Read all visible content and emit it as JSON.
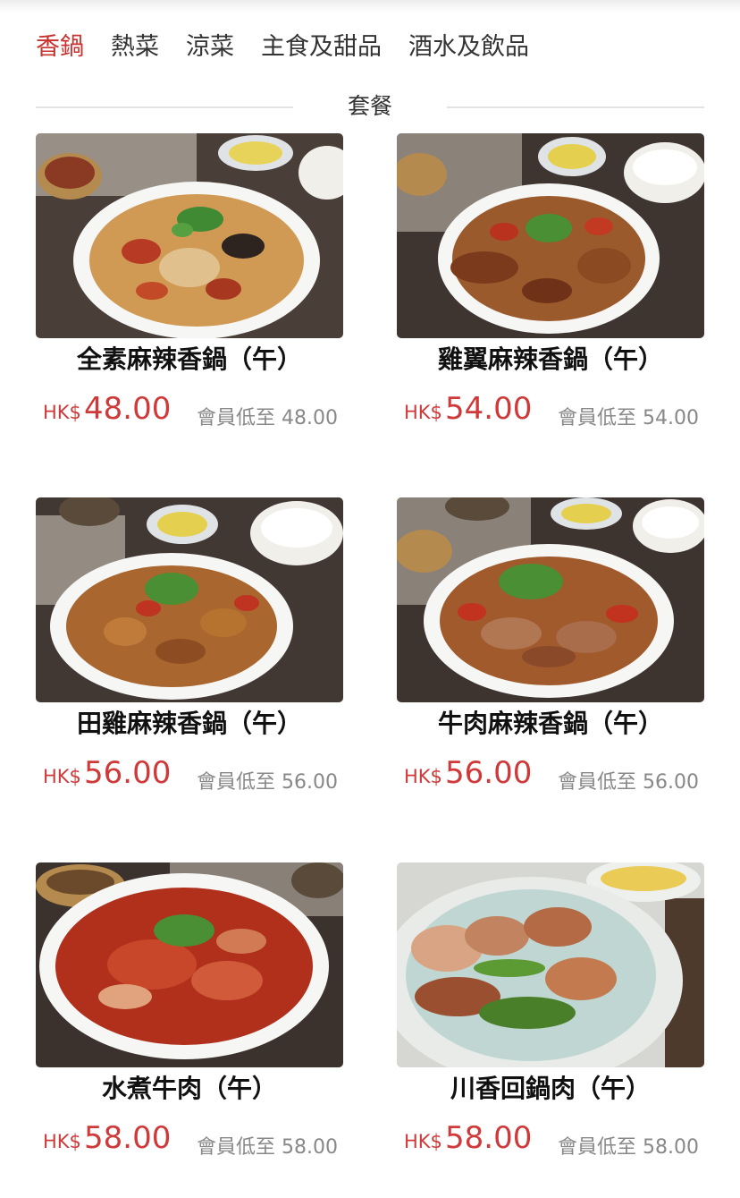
{
  "tabs": [
    {
      "label": "香鍋",
      "active": true
    },
    {
      "label": "熱菜",
      "active": false
    },
    {
      "label": "涼菜",
      "active": false
    },
    {
      "label": "主食及甜品",
      "active": false
    },
    {
      "label": "酒水及飲品",
      "active": false
    }
  ],
  "section": {
    "title": "套餐"
  },
  "dishes": [
    {
      "name": "全素麻辣香鍋（午）",
      "currency": "HK$",
      "price": "48.00",
      "member_label": "會員低至",
      "member_price": "48.00",
      "photo": "dish-photo"
    },
    {
      "name": "雞翼麻辣香鍋（午）",
      "currency": "HK$",
      "price": "54.00",
      "member_label": "會員低至",
      "member_price": "54.00",
      "photo": "dish-photo"
    },
    {
      "name": "田雞麻辣香鍋（午）",
      "currency": "HK$",
      "price": "56.00",
      "member_label": "會員低至",
      "member_price": "56.00",
      "photo": "dish-photo"
    },
    {
      "name": "牛肉麻辣香鍋（午）",
      "currency": "HK$",
      "price": "56.00",
      "member_label": "會員低至",
      "member_price": "56.00",
      "photo": "dish-photo"
    },
    {
      "name": "水煮牛肉（午）",
      "currency": "HK$",
      "price": "58.00",
      "member_label": "會員低至",
      "member_price": "58.00",
      "photo": "dish-photo"
    },
    {
      "name": "川香回鍋肉（午）",
      "currency": "HK$",
      "price": "58.00",
      "member_label": "會員低至",
      "member_price": "58.00",
      "photo": "dish-photo"
    }
  ],
  "colors": {
    "accent": "#c8322e",
    "price": "#d0393a",
    "muted": "#888888",
    "divider": "#e3e3e3"
  }
}
